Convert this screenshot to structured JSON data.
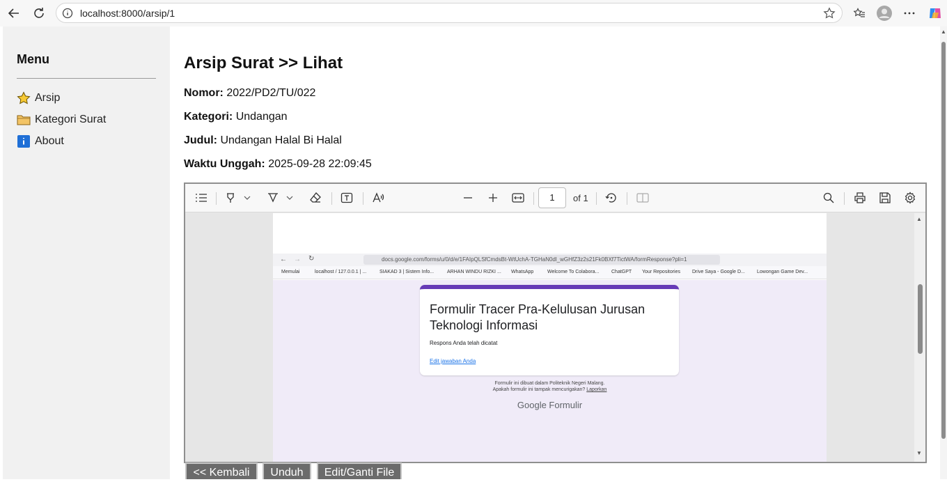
{
  "browser": {
    "url": "localhost:8000/arsip/1"
  },
  "sidebar": {
    "title": "Menu",
    "items": [
      {
        "label": "Arsip",
        "icon": "star-icon"
      },
      {
        "label": "Kategori Surat",
        "icon": "folder-icon"
      },
      {
        "label": "About",
        "icon": "info-icon"
      }
    ]
  },
  "main": {
    "heading": "Arsip Surat >> Lihat",
    "fields": [
      {
        "label": "Nomor:",
        "value": "2022/PD2/TU/022"
      },
      {
        "label": "Kategori:",
        "value": "Undangan"
      },
      {
        "label": "Judul:",
        "value": "Undangan Halal Bi Halal"
      },
      {
        "label": "Waktu Unggah:",
        "value": "2025-09-28 22:09:45"
      }
    ]
  },
  "pdf_viewer": {
    "page_number": "1",
    "page_of": "of 1",
    "document": {
      "url": "docs.google.com/forms/u/0/d/e/1FAIpQLSfCmdsBt-WtUchA-TGHaN0dl_wGHfZ3z2s21Fk0BXf7TictWA/formResponse?pli=1",
      "bookmarks": [
        "Memulai",
        "localhost / 127.0.0.1 | ...",
        "SIAKAD 3 | Sistem Info...",
        "ARHAN WINDU RIZKI ...",
        "WhatsApp",
        "Welcome To Colabora...",
        "ChatGPT",
        "Your Repositories",
        "Drive Saya - Google D...",
        "Lowongan Game Dev..."
      ],
      "form_title": "Formulir Tracer Pra-Kelulusan Jurusan Teknologi Informasi",
      "response_text": "Respons Anda telah dicatat",
      "edit_link": "Edit jawaban Anda",
      "footer_line1": "Formulir ini dibuat dalam Politeknik Negeri Malang.",
      "footer_line2": "Apakah formulir ini tampak mencurigakan?",
      "footer_report": "Laporkan",
      "logo": "Google Formulir"
    }
  },
  "buttons": {
    "back": "<< Kembali",
    "download": "Unduh",
    "edit": "Edit/Ganti File"
  },
  "colors": {
    "form_accent": "#673ab7",
    "form_background": "#f0ebf8",
    "button_bg": "#6b6b6b",
    "sidebar_bg": "#f1f1f1"
  }
}
